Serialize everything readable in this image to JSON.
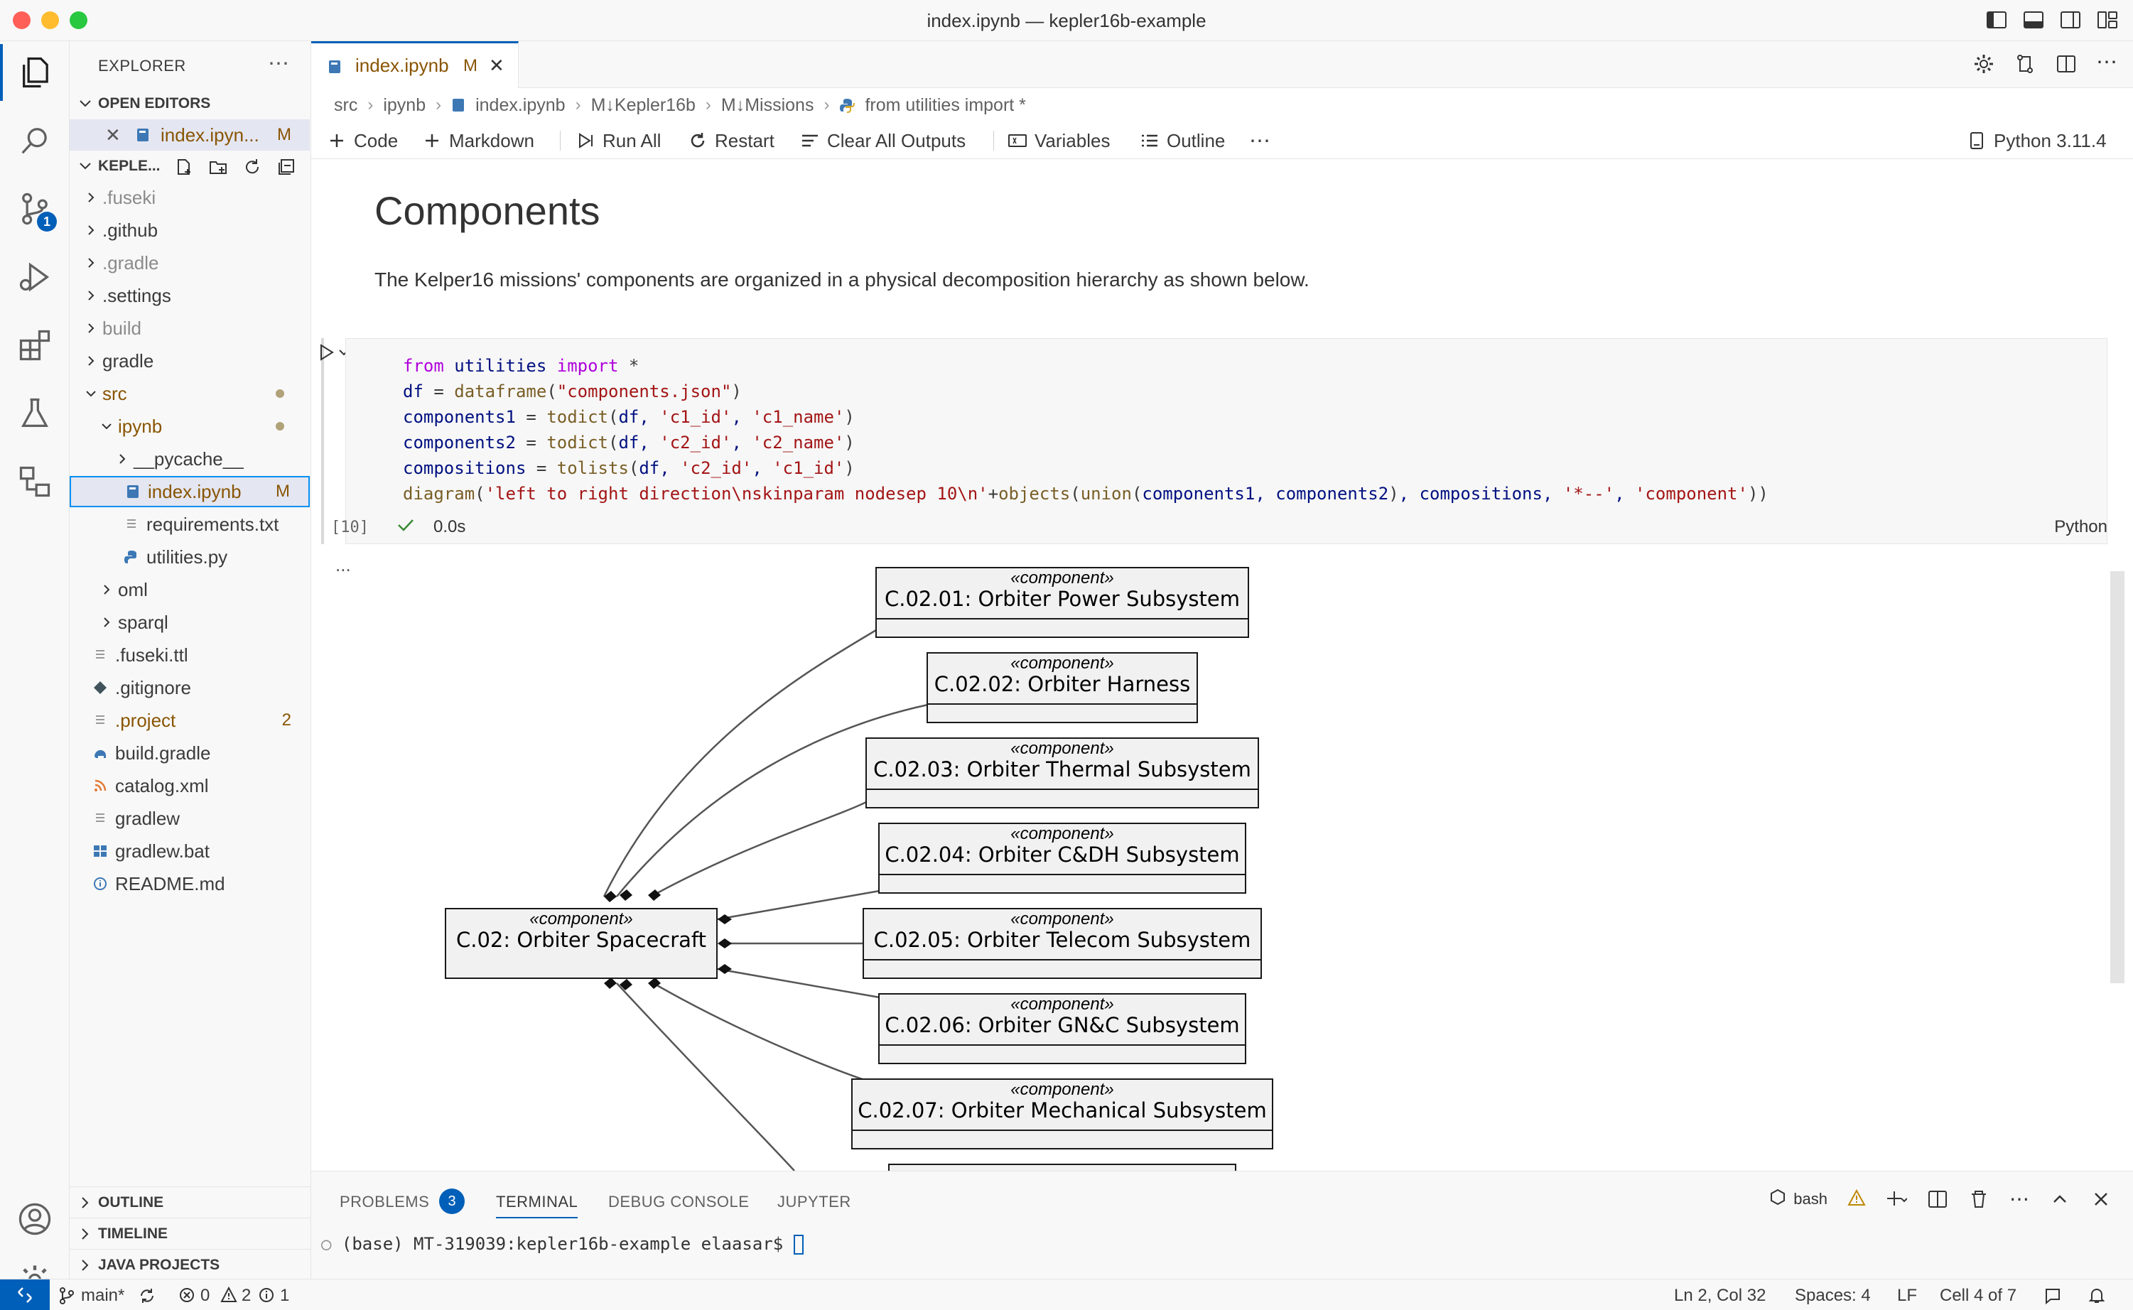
{
  "window": {
    "title": "index.ipynb — kepler16b-example",
    "colors": {
      "accent": "#005fb8",
      "close": "#ff5f57",
      "minimize": "#febc2e",
      "maximize": "#28c840",
      "modified": "#895503",
      "folder_dim": "#8b8b8b"
    }
  },
  "activity_bar": {
    "items": [
      "files-icon",
      "search-icon",
      "source-control-icon",
      "run-debug-icon",
      "extensions-icon",
      "testing-icon",
      "remote-explorer-icon"
    ],
    "source_control_badge": "1",
    "bottom": [
      "account-icon",
      "settings-gear-icon"
    ]
  },
  "sidebar": {
    "title": "EXPLORER",
    "open_editors_label": "OPEN EDITORS",
    "open_editor_item": {
      "name": "index.ipyn...",
      "status": "M"
    },
    "project_label": "KEPLE...",
    "tree": [
      {
        "name": ".fuseki",
        "type": "folder",
        "dim": true
      },
      {
        "name": ".github",
        "type": "folder"
      },
      {
        "name": ".gradle",
        "type": "folder",
        "dim": true
      },
      {
        "name": ".settings",
        "type": "folder"
      },
      {
        "name": "build",
        "type": "folder",
        "dim": true
      },
      {
        "name": "gradle",
        "type": "folder"
      },
      {
        "name": "src",
        "type": "folder-open",
        "modified": true
      },
      {
        "name": "ipynb",
        "type": "folder-open",
        "modified": true
      },
      {
        "name": "__pycache__",
        "type": "folder"
      },
      {
        "name": "index.ipynb",
        "type": "notebook",
        "status": "M",
        "selected": true
      },
      {
        "name": "requirements.txt",
        "type": "text"
      },
      {
        "name": "utilities.py",
        "type": "python"
      },
      {
        "name": "oml",
        "type": "folder"
      },
      {
        "name": "sparql",
        "type": "folder"
      },
      {
        "name": ".fuseki.ttl",
        "type": "text"
      },
      {
        "name": ".gitignore",
        "type": "git"
      },
      {
        "name": ".project",
        "type": "text",
        "status": "2",
        "modified": true
      },
      {
        "name": "build.gradle",
        "type": "gradle"
      },
      {
        "name": "catalog.xml",
        "type": "xml"
      },
      {
        "name": "gradlew",
        "type": "text"
      },
      {
        "name": "gradlew.bat",
        "type": "windows"
      },
      {
        "name": "README.md",
        "type": "info"
      }
    ],
    "sections": [
      "OUTLINE",
      "TIMELINE",
      "JAVA PROJECTS"
    ]
  },
  "editor": {
    "tab": {
      "name": "index.ipynb",
      "status": "M"
    },
    "breadcrumb": [
      "src",
      "ipynb",
      "index.ipynb",
      "M↓Kepler16b",
      "M↓Missions",
      "from utilities import *"
    ],
    "toolbar": {
      "code": "Code",
      "markdown": "Markdown",
      "run_all": "Run All",
      "restart": "Restart",
      "clear": "Clear All Outputs",
      "variables": "Variables",
      "outline": "Outline",
      "more": "⋯",
      "kernel": "Python 3.11.4"
    },
    "markdown": {
      "heading": "Components",
      "paragraph": "The Kelper16 missions' components are organized in a physical decomposition hierarchy as shown below."
    },
    "cell": {
      "execution_count": "[10]",
      "time": "0.0s",
      "language": "Python",
      "code_lines": [
        "from utilities import *",
        "df = dataframe(\"components.json\")",
        "components1 = todict(df, 'c1_id', 'c1_name')",
        "components2 = todict(df, 'c2_id', 'c2_name')",
        "compositions = tolists(df, 'c2_id', 'c1_id')",
        "diagram('left to right direction\\nskinparam nodesep 10\\n'+objects(union(components1, components2), compositions, '*--', 'component'))"
      ],
      "output_dots": "..."
    },
    "diagram": {
      "stereotype": "«component»",
      "root": "C.02: Orbiter Spacecraft",
      "children": [
        "C.02.01: Orbiter Power Subsystem",
        "C.02.02: Orbiter Harness",
        "C.02.03: Orbiter Thermal Subsystem",
        "C.02.04: Orbiter C&DH Subsystem",
        "C.02.05: Orbiter Telecom Subsystem",
        "C.02.06: Orbiter GN&C Subsystem",
        "C.02.07: Orbiter Mechanical Subsystem"
      ]
    }
  },
  "panel": {
    "tabs": [
      "PROBLEMS",
      "TERMINAL",
      "DEBUG CONSOLE",
      "JUPYTER"
    ],
    "problems_count": "3",
    "active_tab": "TERMINAL",
    "shell": "bash",
    "terminal_line": "(base) MT-319039:kepler16b-example elaasar$ "
  },
  "status_bar": {
    "branch": "main*",
    "errors": "0",
    "warnings": "2",
    "info": "1",
    "position": "Ln 2, Col 32",
    "spaces": "Spaces: 4",
    "eol": "LF",
    "cell": "Cell 4 of 7"
  }
}
